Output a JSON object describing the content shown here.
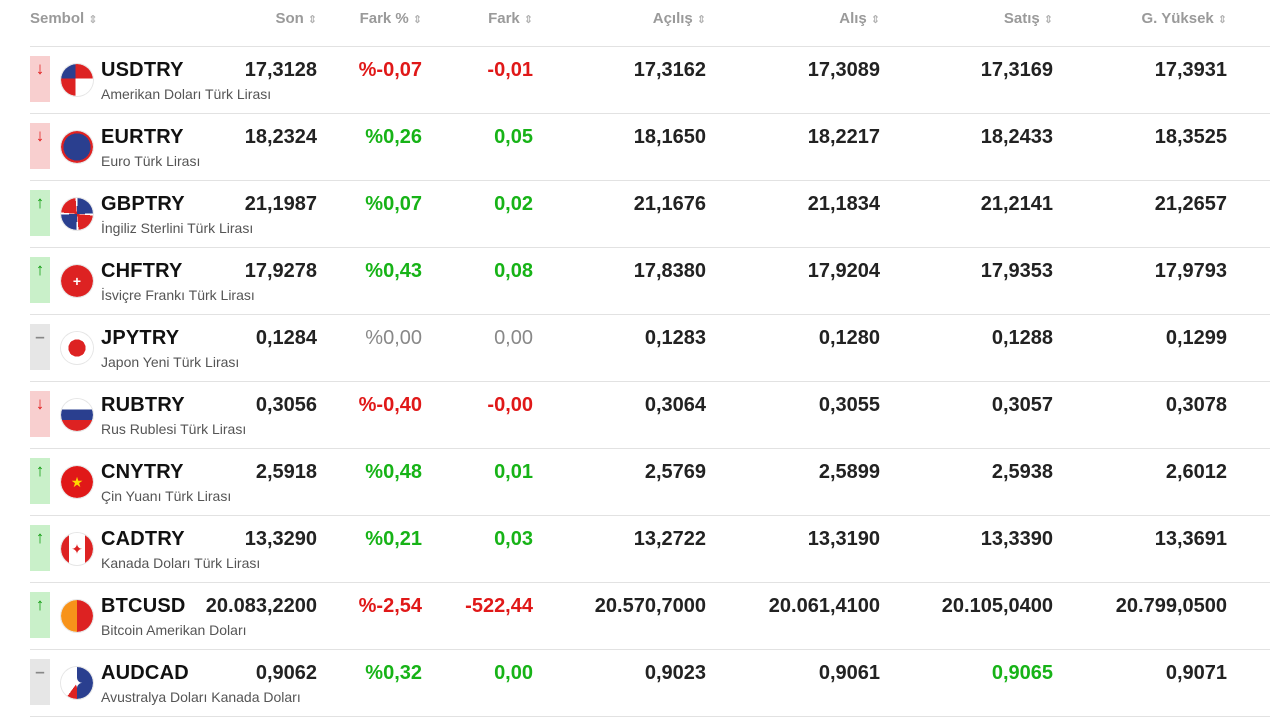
{
  "header": {
    "symbol": "Sembol",
    "last": "Son",
    "change_pct": "Fark %",
    "change": "Fark",
    "open": "Açılış",
    "bid": "Alış",
    "ask": "Satış",
    "high": "G. Yüksek",
    "sort_glyph": "⇕"
  },
  "rows": [
    {
      "trend": "down",
      "flag": "us",
      "code": "USDTRY",
      "desc": "Amerikan Doları Türk Lirası",
      "last": "17,3128",
      "pct": "%-0,07",
      "chg": "-0,01",
      "dir": "neg",
      "open": "17,3162",
      "bid": "17,3089",
      "ask": "17,3169",
      "high": "17,3931"
    },
    {
      "trend": "down",
      "flag": "eu",
      "code": "EURTRY",
      "desc": "Euro Türk Lirası",
      "last": "18,2324",
      "pct": "%0,26",
      "chg": "0,05",
      "dir": "pos",
      "open": "18,1650",
      "bid": "18,2217",
      "ask": "18,2433",
      "high": "18,3525"
    },
    {
      "trend": "up",
      "flag": "gb",
      "code": "GBPTRY",
      "desc": "İngiliz Sterlini Türk Lirası",
      "last": "21,1987",
      "pct": "%0,07",
      "chg": "0,02",
      "dir": "pos",
      "open": "21,1676",
      "bid": "21,1834",
      "ask": "21,2141",
      "high": "21,2657"
    },
    {
      "trend": "up",
      "flag": "ch",
      "code": "CHFTRY",
      "desc": "İsviçre Frankı Türk Lirası",
      "last": "17,9278",
      "pct": "%0,43",
      "chg": "0,08",
      "dir": "pos",
      "open": "17,8380",
      "bid": "17,9204",
      "ask": "17,9353",
      "high": "17,9793"
    },
    {
      "trend": "flat",
      "flag": "jp",
      "code": "JPYTRY",
      "desc": "Japon Yeni Türk Lirası",
      "last": "0,1284",
      "pct": "%0,00",
      "chg": "0,00",
      "dir": "zero",
      "open": "0,1283",
      "bid": "0,1280",
      "ask": "0,1288",
      "high": "0,1299"
    },
    {
      "trend": "down",
      "flag": "ru",
      "code": "RUBTRY",
      "desc": "Rus Rublesi Türk Lirası",
      "last": "0,3056",
      "pct": "%-0,40",
      "chg": "-0,00",
      "dir": "neg",
      "open": "0,3064",
      "bid": "0,3055",
      "ask": "0,3057",
      "high": "0,3078"
    },
    {
      "trend": "up",
      "flag": "cn",
      "code": "CNYTRY",
      "desc": "Çin Yuanı Türk Lirası",
      "last": "2,5918",
      "pct": "%0,48",
      "chg": "0,01",
      "dir": "pos",
      "open": "2,5769",
      "bid": "2,5899",
      "ask": "2,5938",
      "high": "2,6012"
    },
    {
      "trend": "up",
      "flag": "ca",
      "code": "CADTRY",
      "desc": "Kanada Doları Türk Lirası",
      "last": "13,3290",
      "pct": "%0,21",
      "chg": "0,03",
      "dir": "pos",
      "open": "13,2722",
      "bid": "13,3190",
      "ask": "13,3390",
      "high": "13,3691"
    },
    {
      "trend": "up",
      "flag": "btc",
      "code": "BTCUSD",
      "desc": "Bitcoin Amerikan Doları",
      "last": "20.083,2200",
      "pct": "%-2,54",
      "chg": "-522,44",
      "dir": "neg",
      "open": "20.570,7000",
      "bid": "20.061,4100",
      "ask": "20.105,0400",
      "high": "20.799,0500"
    },
    {
      "trend": "flat",
      "flag": "au",
      "code": "AUDCAD",
      "desc": "Avustralya Doları Kanada Doları",
      "last": "0,9062",
      "pct": "%0,32",
      "chg": "0,00",
      "dir": "pos",
      "open": "0,9023",
      "bid": "0,9061",
      "ask": "0,9065",
      "ask_highlight": true,
      "high": "0,9071"
    }
  ],
  "trend_glyphs": {
    "up": "↑",
    "down": "↓",
    "flat": "–"
  },
  "colors": {
    "positive": "#17b317",
    "negative": "#e01818",
    "neutral": "#888888",
    "up_bg": "#c9f0c9",
    "down_bg": "#f8cfcf",
    "flat_bg": "#e6e6e6"
  }
}
